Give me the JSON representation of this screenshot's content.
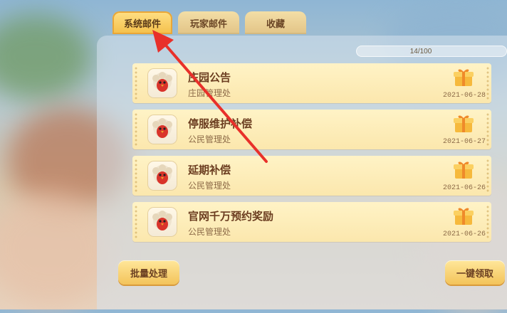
{
  "tabs": [
    {
      "label": "系统邮件",
      "active": true
    },
    {
      "label": "玩家邮件",
      "active": false
    },
    {
      "label": "收藏",
      "active": false
    }
  ],
  "capacity": "14/100",
  "mails": [
    {
      "title": "庄园公告",
      "sender": "庄园管理处",
      "date": "2021-06-28",
      "icon": "gift-box-icon"
    },
    {
      "title": "停服维护补偿",
      "sender": "公民管理处",
      "date": "2021-06-27",
      "icon": "gift-box-icon"
    },
    {
      "title": "延期补偿",
      "sender": "公民管理处",
      "date": "2021-06-26",
      "icon": "gift-box-icon"
    },
    {
      "title": "官网千万预约奖励",
      "sender": "公民管理处",
      "date": "2021-06-26",
      "icon": "gift-box-icon"
    }
  ],
  "buttons": {
    "batch": "批量处理",
    "claim_all": "一键领取"
  },
  "colors": {
    "accent": "#f4bf4a",
    "annotation_arrow": "#e8302a",
    "card": "#fbe7ad"
  }
}
